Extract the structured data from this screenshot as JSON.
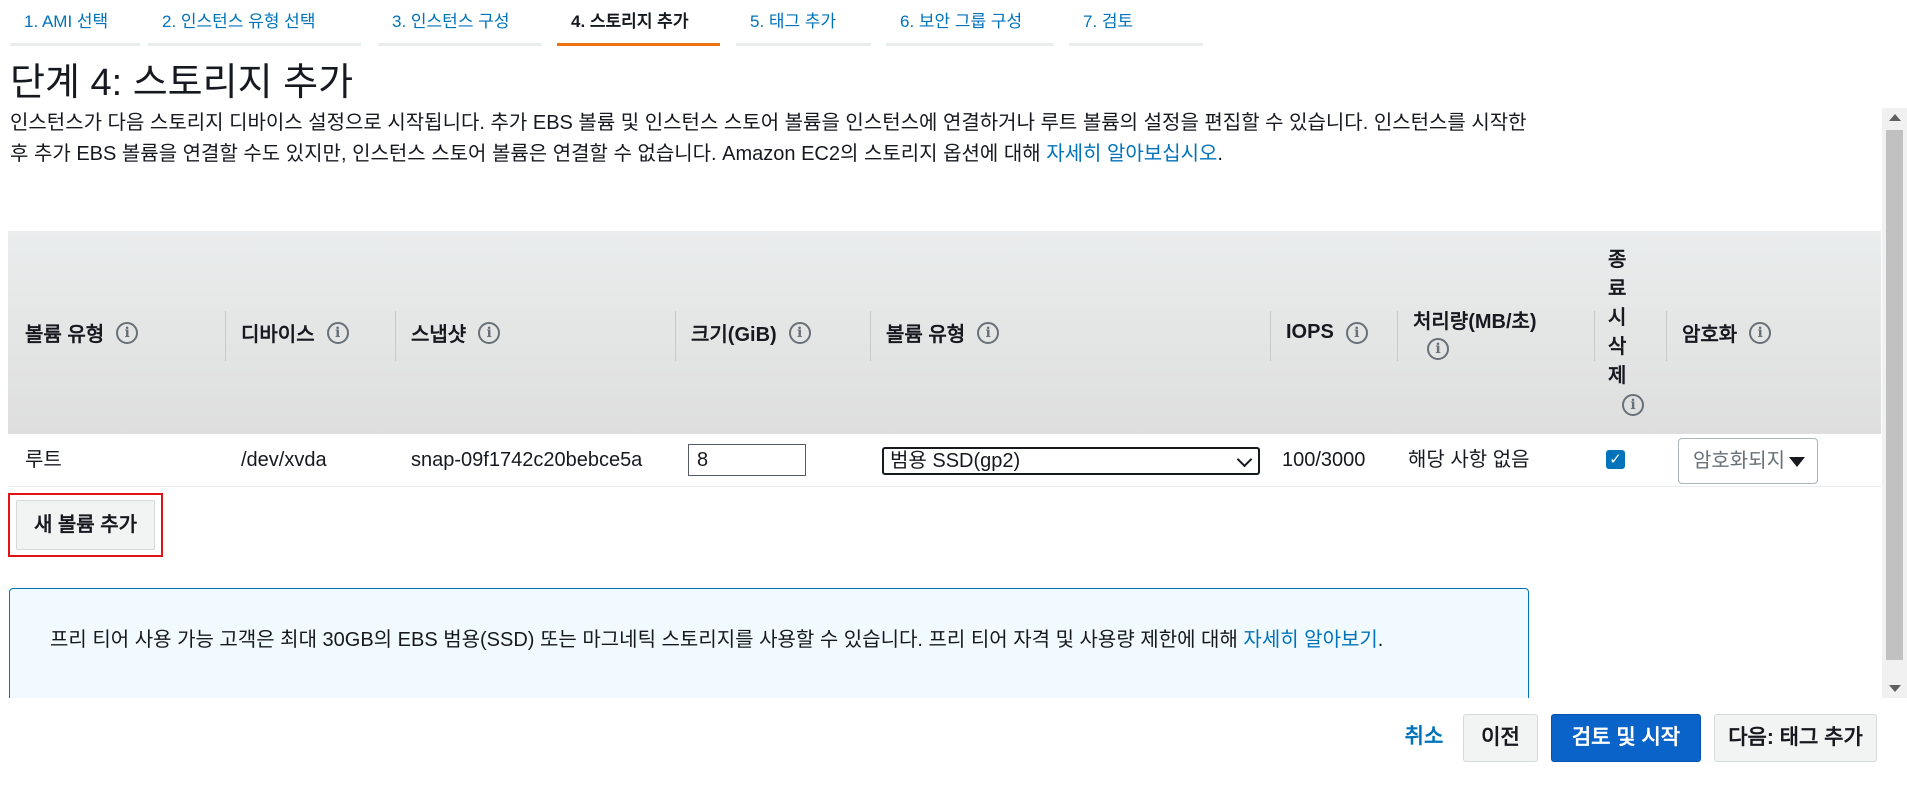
{
  "steps": [
    {
      "label": "1. AMI 선택"
    },
    {
      "label": "2. 인스턴스 유형 선택"
    },
    {
      "label": "3. 인스턴스 구성"
    },
    {
      "label": "4. 스토리지 추가"
    },
    {
      "label": "5. 태그 추가"
    },
    {
      "label": "6. 보안 그룹 구성"
    },
    {
      "label": "7. 검토"
    }
  ],
  "page": {
    "title": "단계 4: 스토리지 추가",
    "intro_text": "인스턴스가 다음 스토리지 디바이스 설정으로 시작됩니다. 추가 EBS 볼륨 및 인스턴스 스토어 볼륨을 인스턴스에 연결하거나 루트 볼륨의 설정을 편집할 수 있습니다. 인스턴스를 시작한 후 추가 EBS 볼륨을 연결할 수도 있지만, 인스턴스 스토어 볼륨은 연결할 수 없습니다. Amazon EC2의 스토리지 옵션에 대해 ",
    "intro_link": "자세히 알아보십시오",
    "intro_end": "."
  },
  "table": {
    "headers": {
      "volume_type": "볼륨 유형",
      "device": "디바이스",
      "snapshot": "스냅샷",
      "size": "크기(GiB)",
      "volume_kind": "볼륨 유형",
      "iops": "IOPS",
      "throughput": "처리량(MB/초)",
      "delete_on_termination": "종료 시 삭제",
      "encryption": "암호화"
    },
    "row": {
      "volume_type": "루트",
      "device": "/dev/xvda",
      "snapshot": "snap-09f1742c20bebce5a",
      "size": "8",
      "volume_kind": "범용 SSD(gp2)",
      "iops": "100/3000",
      "throughput": "해당 사항 없음",
      "delete_on_termination": true,
      "encryption": "암호화되지"
    },
    "info_glyph": "i"
  },
  "add_volume": {
    "label": "새 볼륨 추가"
  },
  "notice": {
    "text": "프리 티어 사용 가능 고객은 최대 30GB의 EBS 범용(SSD) 또는 마그네틱 스토리지를 사용할 수 있습니다. 프리 티어 자격 및 사용량 제한에 대해 ",
    "link": "자세히 알아보기",
    "end": "."
  },
  "footer": {
    "cancel": "취소",
    "previous": "이전",
    "review_launch": "검토 및 시작",
    "next": "다음: 태그 추가"
  }
}
